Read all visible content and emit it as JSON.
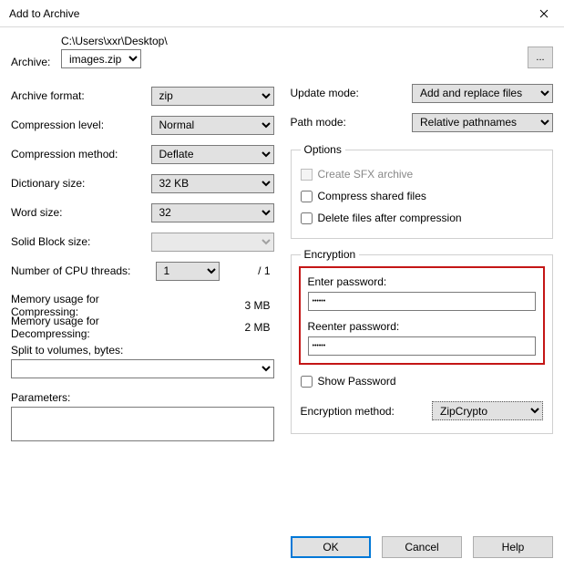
{
  "title": "Add to Archive",
  "archive": {
    "label": "Archive:",
    "path": "C:\\Users\\xxr\\Desktop\\",
    "filename": "images.zip",
    "browse": "..."
  },
  "left": {
    "format_label": "Archive format:",
    "format_value": "zip",
    "level_label": "Compression level:",
    "level_value": "Normal",
    "method_label": "Compression method:",
    "method_value": "Deflate",
    "dict_label": "Dictionary size:",
    "dict_value": "32 KB",
    "word_label": "Word size:",
    "word_value": "32",
    "solid_label": "Solid Block size:",
    "solid_value": "",
    "threads_label": "Number of CPU threads:",
    "threads_value": "1",
    "threads_total": "/ 1",
    "mem_comp_label": "Memory usage for Compressing:",
    "mem_comp_value": "3 MB",
    "mem_decomp_label": "Memory usage for Decompressing:",
    "mem_decomp_value": "2 MB",
    "split_label": "Split to volumes, bytes:",
    "split_value": "",
    "params_label": "Parameters:",
    "params_value": ""
  },
  "right": {
    "update_label": "Update mode:",
    "update_value": "Add and replace files",
    "path_label": "Path mode:",
    "path_value": "Relative pathnames",
    "options": {
      "legend": "Options",
      "sfx": "Create SFX archive",
      "shared": "Compress shared files",
      "delete": "Delete files after compression"
    },
    "encryption": {
      "legend": "Encryption",
      "enter_label": "Enter password:",
      "enter_value": "••••••",
      "reenter_label": "Reenter password:",
      "reenter_value": "••••••",
      "show": "Show Password",
      "method_label": "Encryption method:",
      "method_value": "ZipCrypto"
    }
  },
  "buttons": {
    "ok": "OK",
    "cancel": "Cancel",
    "help": "Help"
  }
}
